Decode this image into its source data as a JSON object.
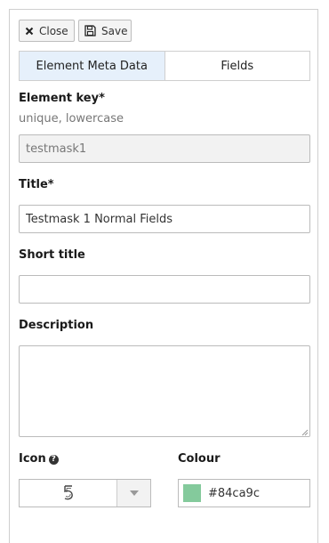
{
  "toolbar": {
    "close_label": "Close",
    "save_label": "Save"
  },
  "tabs": [
    {
      "label": "Element Meta Data",
      "active": true
    },
    {
      "label": "Fields",
      "active": false
    }
  ],
  "form": {
    "element_key": {
      "label": "Element key*",
      "hint": "unique, lowercase",
      "value": "testmask1"
    },
    "title": {
      "label": "Title*",
      "value": "Testmask 1 Normal Fields"
    },
    "short_title": {
      "label": "Short title",
      "value": ""
    },
    "description": {
      "label": "Description",
      "value": ""
    },
    "icon": {
      "label": "Icon",
      "selected": "five-icon"
    },
    "colour": {
      "label": "Colour",
      "value": "#84ca9c"
    }
  },
  "colors": {
    "active_tab": "#e6f0fb",
    "swatch": "#84ca9c"
  }
}
